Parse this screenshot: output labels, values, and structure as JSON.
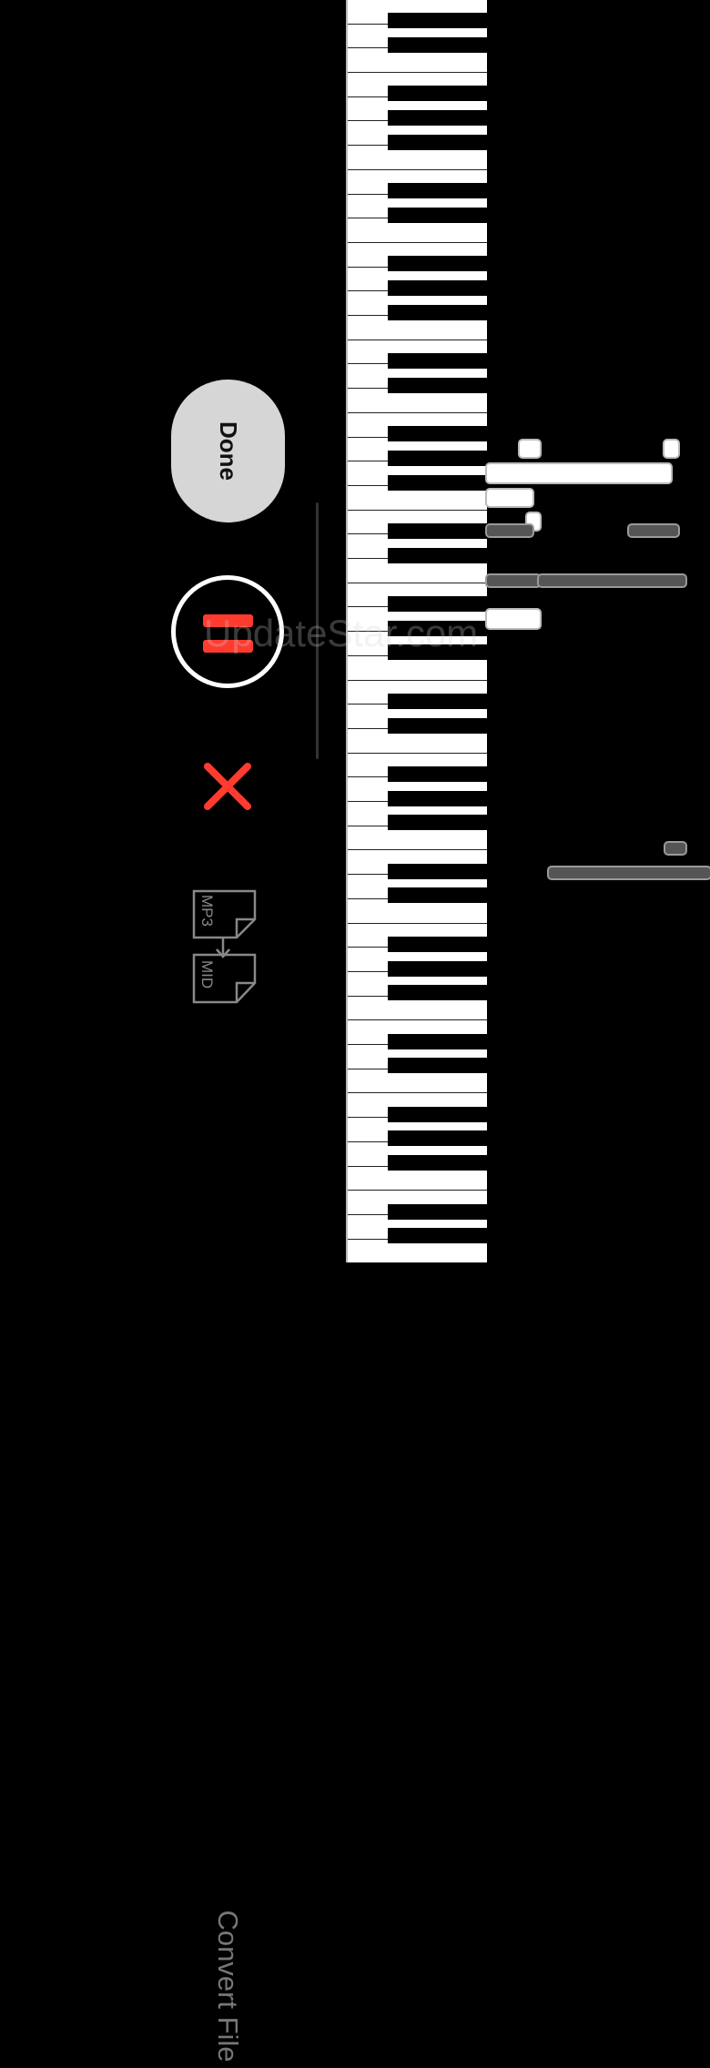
{
  "buttons": {
    "done_label": "Done",
    "convert_label": "Convert File"
  },
  "convert_icon": {
    "from_format": "MP3",
    "to_format": "MID"
  },
  "watermark": "UpdateStar.com",
  "colors": {
    "background": "#000000",
    "accent_red": "#ff3b30",
    "done_button": "#d6d6d6",
    "note_active": "#ffffff",
    "note_inactive": "#555555",
    "convert_gray": "#777777"
  },
  "icons": [
    "pause-icon",
    "close-icon",
    "mp3-file-icon",
    "midi-file-icon",
    "convert-arrow-icon"
  ]
}
